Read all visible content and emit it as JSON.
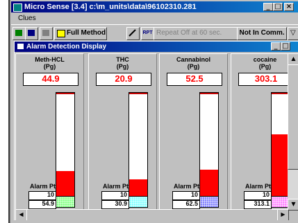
{
  "window": {
    "title": "Micro Sense [3.4] c:\\m_units\\data\\96102310.281",
    "buttons": {
      "minimize": "_",
      "maximize": "□",
      "close": "×"
    }
  },
  "menu": {
    "items": [
      "Clues"
    ]
  },
  "toolbar": {
    "method_label": "Full Method",
    "rpt_label": "RPT",
    "repeat_label": "Repeat Off at  60 sec.",
    "status_label": "Not In Comm."
  },
  "child_window": {
    "title": "Alarm Detection Display",
    "buttons": {
      "minimize": "_",
      "maximize": "□"
    }
  },
  "alarm_label": "Alarm Pt",
  "panels": [
    {
      "name": "Meth-HCL",
      "unit": "(Pg)",
      "reading": "44.9",
      "alarm": "10",
      "peak": "54.9",
      "fill": 0.25,
      "swatch": "#80ff80"
    },
    {
      "name": "THC",
      "unit": "(Pg)",
      "reading": "20.9",
      "alarm": "10",
      "peak": "30.9",
      "fill": 0.17,
      "swatch": "#80ffff"
    },
    {
      "name": "Cannabinol",
      "unit": "(Pg)",
      "reading": "52.5",
      "alarm": "10",
      "peak": "62.5",
      "fill": 0.26,
      "swatch": "#8080ff"
    },
    {
      "name": "cocaine",
      "unit": "(Pg)",
      "reading": "303.1",
      "alarm": "10",
      "peak": "313.1",
      "fill": 0.6,
      "swatch": "#ff80ff"
    }
  ],
  "colors": {
    "title_bar": "#000080",
    "gauge_fill": "#ff0000",
    "reading_text": "#ff0000",
    "window_bg": "#c0c0c0"
  }
}
